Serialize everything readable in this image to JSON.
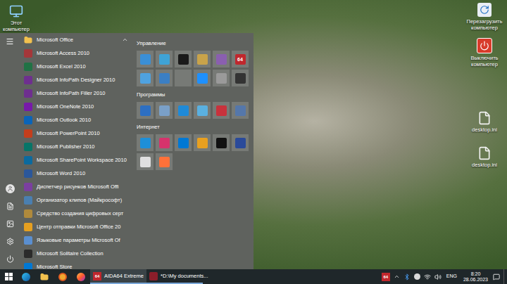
{
  "desktop": {
    "icons": [
      {
        "label": "Этот компьютер"
      },
      {
        "label": "Перезагрузить компьютер"
      },
      {
        "label": "Выключить компьютер"
      },
      {
        "label": "desktop.ini"
      },
      {
        "label": "desktop.ini"
      }
    ]
  },
  "start_menu": {
    "group": {
      "label": "Microsoft Office",
      "expanded": true
    },
    "items": [
      {
        "label": "Microsoft Access 2010"
      },
      {
        "label": "Microsoft Excel 2010"
      },
      {
        "label": "Microsoft InfoPath Designer 2010"
      },
      {
        "label": "Microsoft InfoPath Filler 2010"
      },
      {
        "label": "Microsoft OneNote 2010"
      },
      {
        "label": "Microsoft Outlook 2010"
      },
      {
        "label": "Microsoft PowerPoint 2010"
      },
      {
        "label": "Microsoft Publisher 2010"
      },
      {
        "label": "Microsoft SharePoint Workspace 2010"
      },
      {
        "label": "Microsoft Word 2010"
      },
      {
        "label": "Диспетчер рисунков Microsoft Offi"
      },
      {
        "label": "Организатор клипов (Майкрософт)"
      },
      {
        "label": "Средство создания цифровых серт"
      },
      {
        "label": "Центр отправки Microsoft Office 20"
      },
      {
        "label": "Языковые параметры Microsoft Of"
      },
      {
        "label": "Microsoft Solitaire Collection"
      },
      {
        "label": "Microsoft Store"
      }
    ],
    "tile_groups": [
      {
        "title": "Управление",
        "tiles": [
          {
            "text": ""
          },
          {
            "text": ""
          },
          {
            "text": ""
          },
          {
            "text": ""
          },
          {
            "text": ""
          },
          {
            "text": "64"
          },
          {
            "text": ""
          },
          {
            "text": ""
          },
          {
            "text": ""
          },
          {
            "text": ""
          },
          {
            "text": ""
          },
          {
            "text": ""
          }
        ]
      },
      {
        "title": "Программы",
        "tiles": [
          {
            "text": ""
          },
          {
            "text": ""
          },
          {
            "text": ""
          },
          {
            "text": ""
          },
          {
            "text": ""
          },
          {
            "text": ""
          }
        ]
      },
      {
        "title": "Интернет",
        "tiles": [
          {
            "text": ""
          },
          {
            "text": ""
          },
          {
            "text": ""
          },
          {
            "text": ""
          },
          {
            "text": ""
          },
          {
            "text": ""
          },
          {
            "text": ""
          },
          {
            "text": ""
          }
        ]
      }
    ]
  },
  "taskbar": {
    "windows": [
      {
        "label": "AIDA64 Extreme",
        "icon_text": "64",
        "selected": true
      },
      {
        "label": "*D:\\My documents...",
        "icon_text": "",
        "selected": false
      }
    ],
    "tray": {
      "badge": "64",
      "language": "ENG",
      "time": "8:20",
      "date": "28.06.2023"
    }
  }
}
